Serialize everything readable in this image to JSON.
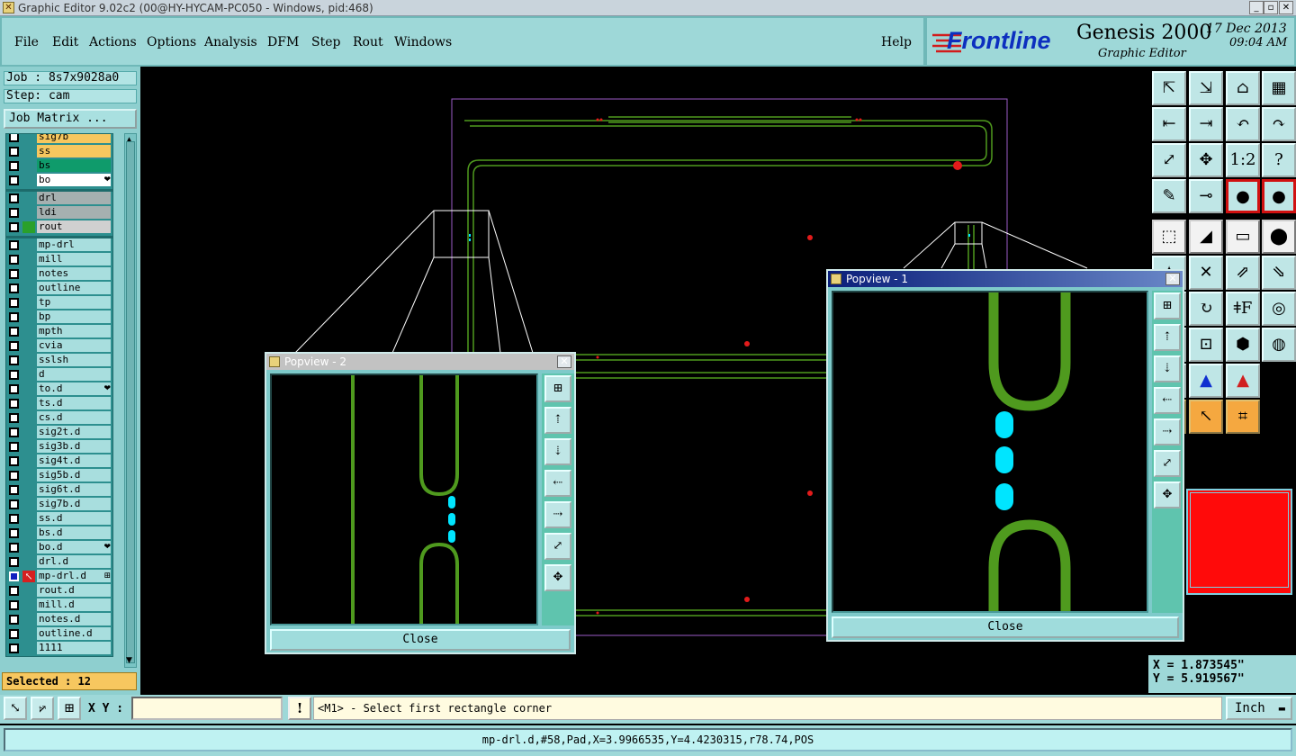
{
  "window": {
    "title": "Graphic Editor 9.02c2 (00@HY-HYCAM-PC050 - Windows, pid:468)",
    "minimize": "_",
    "restore": "▫",
    "close": "✕"
  },
  "menu": {
    "items": [
      "File",
      "Edit",
      "Actions",
      "Options",
      "Analysis",
      "DFM",
      "Step",
      "Rout",
      "Windows"
    ],
    "help": "Help"
  },
  "brand": {
    "logo": "Frontline",
    "product": "Genesis 2000",
    "subtitle": "Graphic Editor",
    "date": "17 Dec 2013",
    "time": "09:04 AM"
  },
  "job": {
    "job_label": "Job : 8s7x9028a0",
    "step_label": "Step: cam",
    "matrix_button": "Job Matrix ..."
  },
  "layers": [
    {
      "name": "sig7b",
      "color": "#f7c75f",
      "flag": ""
    },
    {
      "name": "ss",
      "color": "#f7c75f",
      "flag": ""
    },
    {
      "name": "bs",
      "color": "#0f9b6b",
      "flag": ""
    },
    {
      "name": "bo",
      "color": "#ffffff",
      "flag": "❤"
    },
    {
      "name": "drl",
      "color": "#a5b0b0",
      "flag": ""
    },
    {
      "name": "ldi",
      "color": "#a5b0b0",
      "flag": ""
    },
    {
      "name": "rout",
      "color": "#d0d0d0",
      "flag": "",
      "active_color": "#2aa02a"
    },
    {
      "name": "mp-drl",
      "color": "#a8dede",
      "flag": ""
    },
    {
      "name": "mill",
      "color": "#a8dede",
      "flag": ""
    },
    {
      "name": "notes",
      "color": "#a8dede",
      "flag": ""
    },
    {
      "name": "outline",
      "color": "#a8dede",
      "flag": ""
    },
    {
      "name": "tp",
      "color": "#a8dede",
      "flag": ""
    },
    {
      "name": "bp",
      "color": "#a8dede",
      "flag": ""
    },
    {
      "name": "mpth",
      "color": "#a8dede",
      "flag": ""
    },
    {
      "name": "cvia",
      "color": "#a8dede",
      "flag": ""
    },
    {
      "name": "sslsh",
      "color": "#a8dede",
      "flag": ""
    },
    {
      "name": "d",
      "color": "#a8dede",
      "flag": ""
    },
    {
      "name": "to.d",
      "color": "#a8dede",
      "flag": "❤"
    },
    {
      "name": "ts.d",
      "color": "#a8dede",
      "flag": ""
    },
    {
      "name": "cs.d",
      "color": "#a8dede",
      "flag": ""
    },
    {
      "name": "sig2t.d",
      "color": "#a8dede",
      "flag": ""
    },
    {
      "name": "sig3b.d",
      "color": "#a8dede",
      "flag": ""
    },
    {
      "name": "sig4t.d",
      "color": "#a8dede",
      "flag": ""
    },
    {
      "name": "sig5b.d",
      "color": "#a8dede",
      "flag": ""
    },
    {
      "name": "sig6t.d",
      "color": "#a8dede",
      "flag": ""
    },
    {
      "name": "sig7b.d",
      "color": "#a8dede",
      "flag": ""
    },
    {
      "name": "ss.d",
      "color": "#a8dede",
      "flag": ""
    },
    {
      "name": "bs.d",
      "color": "#a8dede",
      "flag": ""
    },
    {
      "name": "bo.d",
      "color": "#a8dede",
      "flag": "❤"
    },
    {
      "name": "drl.d",
      "color": "#a8dede",
      "flag": ""
    },
    {
      "name": "mp-drl.d",
      "color": "#a8dede",
      "flag": "⊞",
      "work": true
    },
    {
      "name": "rout.d",
      "color": "#a8dede",
      "flag": ""
    },
    {
      "name": "mill.d",
      "color": "#a8dede",
      "flag": ""
    },
    {
      "name": "notes.d",
      "color": "#a8dede",
      "flag": ""
    },
    {
      "name": "outline.d",
      "color": "#a8dede",
      "flag": ""
    },
    {
      "name": "1111",
      "color": "#a8dede",
      "flag": ""
    }
  ],
  "selected": "Selected : 12",
  "toolbar_icons": [
    "zoom-in-icon",
    "zoom-out-icon",
    "home-icon",
    "split-view-icon",
    "pan-left-icon",
    "pan-right-icon",
    "undo-zoom-icon",
    "redo-zoom-icon",
    "fit-icon",
    "center-icon",
    "one-to-one-icon",
    "help-icon",
    "tools-icon",
    "snap-icon",
    "traffic-light-icon",
    "traffic-light-red-icon",
    "select-icon",
    "polygon-icon",
    "ruler-icon",
    "pad-icon",
    "features-icon",
    "cross-icon",
    "move-icon",
    "copy-icon",
    "line-icon",
    "arc-icon",
    "text-icon",
    "surface-icon",
    "resize-icon",
    "measure-icon",
    "symbol-icon",
    "bp-icon",
    "triangle-red-icon",
    "triangle-blue-icon",
    "triangle-mix-icon",
    "pointer-icon",
    "pointer-alt-icon",
    "net-icon"
  ],
  "toolbar_labels": [
    "⇱",
    "⇲",
    "⌂",
    "▦",
    "⇤",
    "⇥",
    "↶",
    "↷",
    "⤢",
    "✥",
    "1:2",
    "?",
    "✎",
    "⊸",
    "●",
    "●",
    "⬚",
    "◢",
    "▭",
    "⬤",
    "✦",
    "✕",
    "⇗",
    "⇘",
    "╱",
    "↻",
    "ǂF",
    "◎",
    "—",
    "⊡",
    "⬢",
    "◍",
    "▲",
    "▲",
    "▲",
    "↖",
    "↖",
    "⌗"
  ],
  "coords": {
    "x": "X = 1.873545\"",
    "y": "Y = 5.919567\""
  },
  "command": {
    "xy_label": "X Y :",
    "xy_value": "",
    "exclaim": "!",
    "prompt": "<M1> - Select first rectangle corner",
    "unit": "Inch"
  },
  "status": "mp-drl.d,#58,Pad,X=3.9966535,Y=4.4230315,r78.74,POS",
  "popup1": {
    "title": "Popview - 1",
    "close": "Close",
    "close_icon": "✕"
  },
  "popup2": {
    "title": "Popview - 2",
    "close": "Close",
    "close_icon": "✕"
  },
  "colors": {
    "accent": "#9ed8d8",
    "trace": "#4f9a1e",
    "pad": "#00e5ff",
    "drill": "#e21b1b",
    "outline": "#9b5cc9",
    "selection": "#ff0a0a"
  }
}
